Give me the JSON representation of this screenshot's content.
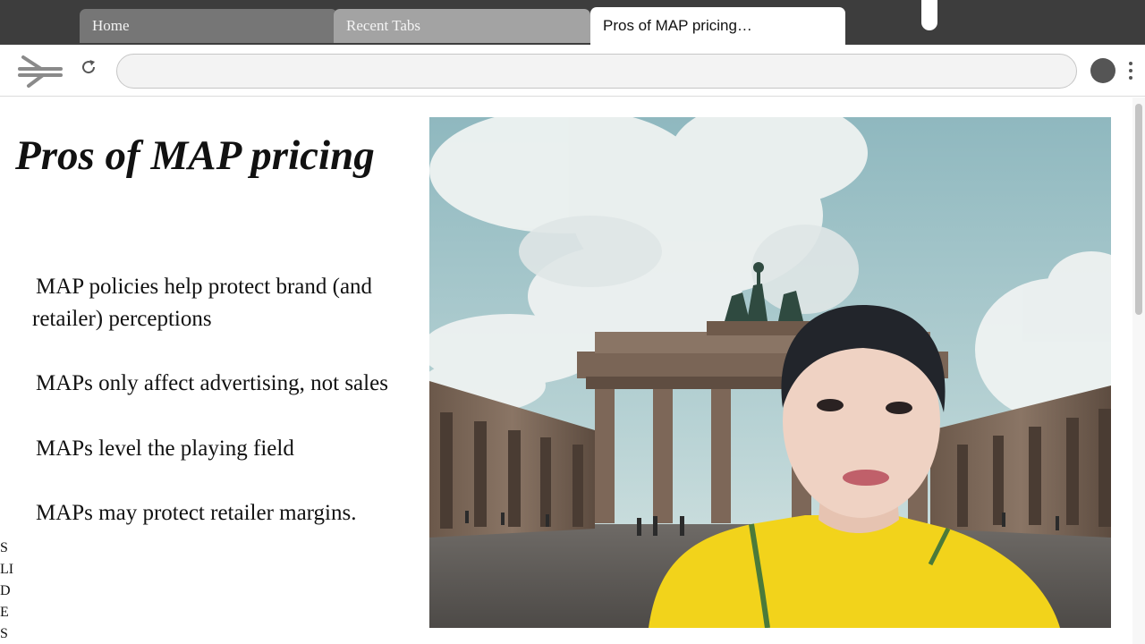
{
  "tabs": [
    {
      "label": "Home"
    },
    {
      "label": "Recent Tabs"
    },
    {
      "label": "Pros of MAP pricing…"
    }
  ],
  "toolbar": {
    "nav_icon": "back-forward-arrows-icon",
    "reload_icon": "reload-icon",
    "address_value": "",
    "profile_icon": "profile-avatar-icon",
    "menu_icon": "vertical-dots-menu-icon"
  },
  "slide": {
    "title": "Pros of MAP pricing",
    "bullets": [
      "MAP policies help protect brand (and retailer) perceptions",
      "MAPs only affect advertising, not sales",
      "MAPs level the playing field",
      "MAPs may protect retailer margins."
    ],
    "vertical_letters": [
      "S",
      "LI",
      "D",
      "E",
      "S"
    ]
  },
  "colors": {
    "tabstrip": "#3d3d3d",
    "tab_home": "#767676",
    "tab_recent": "#a3a3a3",
    "tab_active": "#ffffff",
    "shirt": "#f2d31b"
  }
}
